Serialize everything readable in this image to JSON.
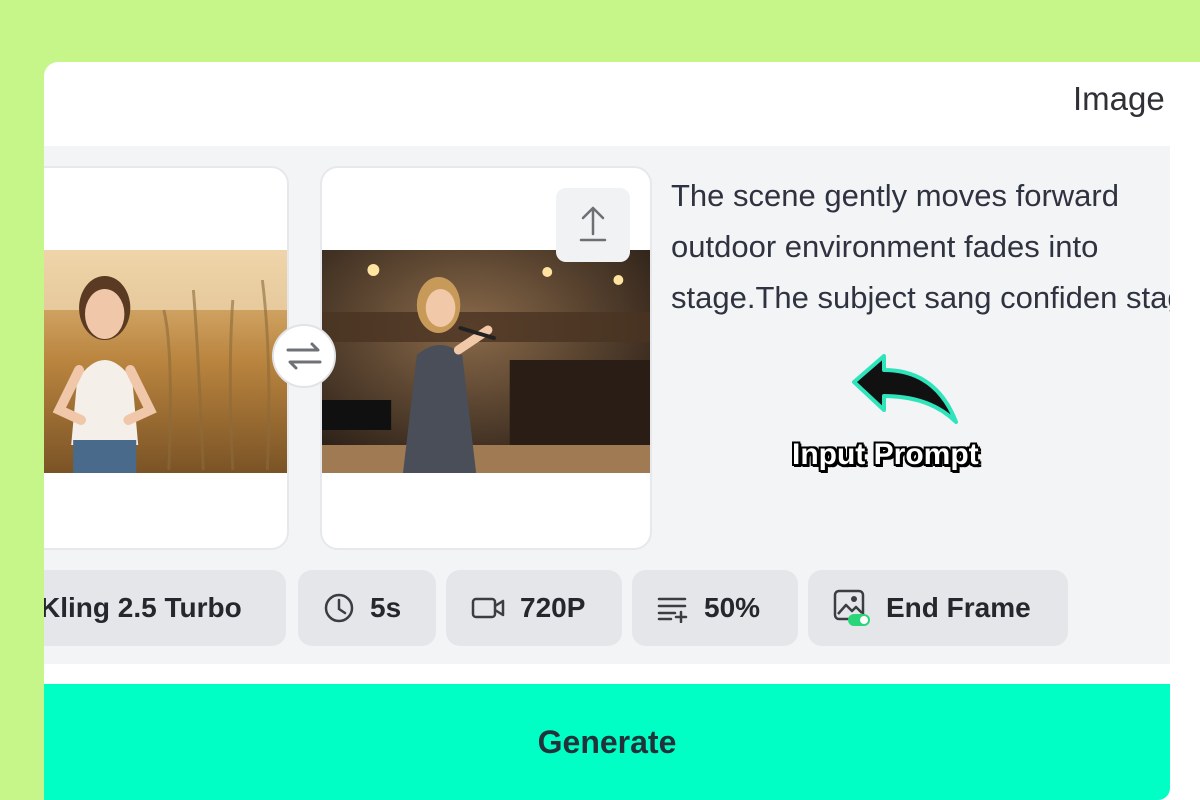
{
  "header": {
    "tab_label": "Image"
  },
  "frames": {
    "start": {
      "description": "girl standing in field of golden grass"
    },
    "end": {
      "description": "young woman singing into microphone on stage"
    }
  },
  "prompt": {
    "text": "The scene gently moves forward outdoor environment fades into stage.The subject sang confiden stage."
  },
  "annotation": {
    "label": "Input Prompt"
  },
  "settings": {
    "model": "Kling 2.5 Turbo",
    "duration": "5s",
    "resolution": "720P",
    "strength": "50%",
    "end_frame": "End Frame"
  },
  "actions": {
    "generate": "Generate"
  },
  "colors": {
    "page_bg": "#c6f68a",
    "generate_bg": "#00ffc4",
    "annotation_teal": "#2de4bb",
    "toggle_on": "#2bd67b"
  },
  "icons": {
    "upload": "upload-icon",
    "swap": "swap-icon",
    "duration": "clock-icon",
    "resolution": "video-camera-icon",
    "strength": "list-plus-icon",
    "end_frame": "image-toggle-icon"
  }
}
